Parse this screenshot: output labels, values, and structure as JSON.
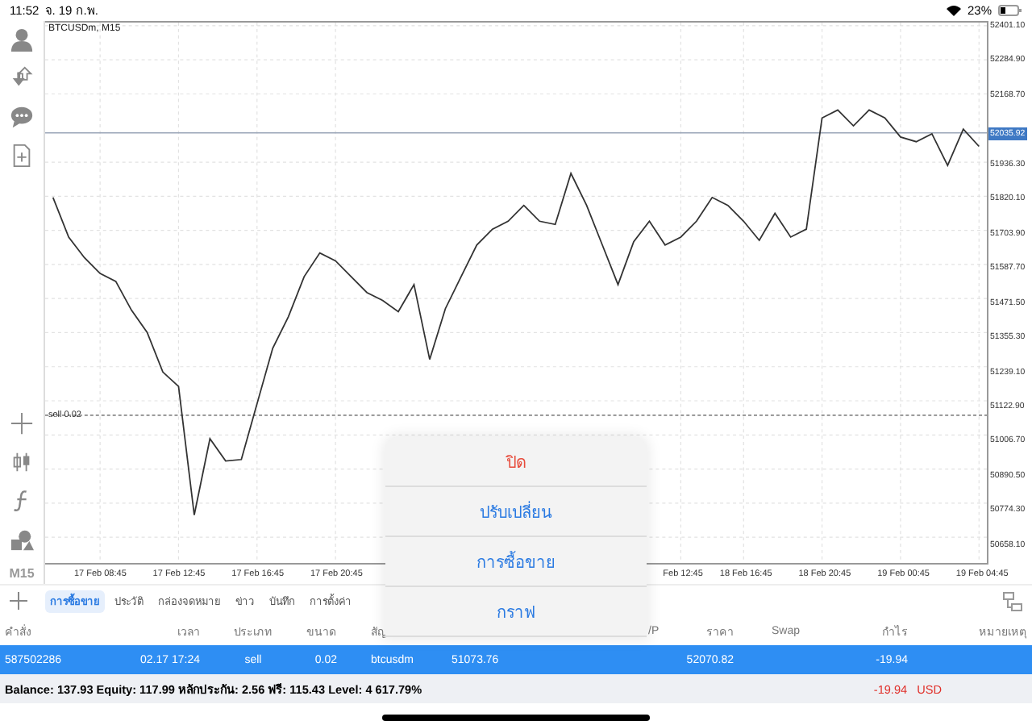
{
  "status_bar": {
    "time": "11:52",
    "date": "จ. 19 ก.พ.",
    "battery": "23%"
  },
  "chart": {
    "timeframe": "M15",
    "chart_data": {
      "type": "line",
      "title": "BTCUSDm, M15",
      "grid": true,
      "ylim": [
        50571.5,
        52411.9
      ],
      "categories": [
        null,
        null,
        null,
        "17 Feb 08:45",
        null,
        null,
        null,
        null,
        "17 Feb 12:45",
        null,
        null,
        null,
        null,
        "17 Feb 16:45",
        null,
        null,
        null,
        null,
        "17 Feb 20:45",
        null,
        null,
        null,
        null,
        null,
        null,
        null,
        null,
        null,
        null,
        null,
        null,
        null,
        null,
        null,
        null,
        null,
        null,
        null,
        null,
        null,
        "Feb 12:45",
        null,
        null,
        null,
        "18 Feb 16:45",
        null,
        null,
        null,
        null,
        "18 Feb 20:45",
        null,
        null,
        null,
        null,
        "19 Feb 00:45",
        null,
        null,
        null,
        null,
        "19 Feb 04:45"
      ],
      "yticks": [
        {
          "value": 52401.1,
          "label": "52401.10"
        },
        {
          "value": 52284.9,
          "label": "52284.90"
        },
        {
          "value": 52168.7,
          "label": "52168.70"
        },
        {
          "value": 51936.3,
          "label": "51936.30"
        },
        {
          "value": 51820.1,
          "label": "51820.10"
        },
        {
          "value": 51703.9,
          "label": "51703.90"
        },
        {
          "value": 51587.7,
          "label": "51587.70"
        },
        {
          "value": 51471.5,
          "label": "51471.50"
        },
        {
          "value": 51355.3,
          "label": "51355.30"
        },
        {
          "value": 51239.1,
          "label": "51239.10"
        },
        {
          "value": 51122.9,
          "label": "51122.90"
        },
        {
          "value": 51006.7,
          "label": "51006.70"
        },
        {
          "value": 50890.5,
          "label": "50890.50"
        },
        {
          "value": 50774.3,
          "label": "50774.30"
        },
        {
          "value": 50658.1,
          "label": "50658.10"
        }
      ],
      "ref_lines": [
        {
          "axis": "y",
          "value": 52035.92,
          "label": "52035.92",
          "color": "#9aa6b8"
        },
        {
          "axis": "y",
          "value": 51073.76,
          "label": "sell 0.02",
          "color": "#888888"
        }
      ],
      "series": [
        {
          "color": "#333333",
          "values": [
            51816,
            51681,
            51611,
            51557,
            51530,
            51432,
            51356,
            51221,
            51172,
            50734,
            50994,
            50918,
            50923,
            51113,
            51302,
            51410,
            51546,
            51627,
            51600,
            51546,
            51492,
            51465,
            51427,
            51519,
            51264,
            51437,
            51546,
            51654,
            51708,
            51735,
            51789,
            51735,
            51724,
            51898,
            51789,
            51654,
            51519,
            51665,
            51735,
            51654,
            51681,
            51735,
            51816,
            51789,
            51735,
            51670,
            51762,
            51681,
            51708,
            52087,
            52114,
            52060,
            52114,
            52087,
            52022,
            52006,
            52033,
            51925,
            52049,
            51990
          ]
        }
      ]
    }
  },
  "tabs": [
    {
      "label": "การซื้อขาย",
      "selected": true
    },
    {
      "label": "ประวัติ",
      "selected": false
    },
    {
      "label": "กล่องจดหมาย",
      "selected": false
    },
    {
      "label": "ข่าว",
      "selected": false
    },
    {
      "label": "บันทึก",
      "selected": false
    },
    {
      "label": "การตั้งค่า",
      "selected": false
    }
  ],
  "table": {
    "columns": [
      "คำสั่ง",
      "เวลา",
      "ประเภท",
      "ขนาด",
      "สัญ",
      null,
      null,
      "/P",
      "ราคา",
      "Swap",
      "กำไร",
      "หมายเหตุ"
    ],
    "rows": [
      {
        "selected": true,
        "cells": [
          "587502286",
          "02.17 17:24",
          "sell",
          "0.02",
          "btcusdm",
          "51073.76",
          null,
          null,
          "52070.82",
          null,
          "-19.94",
          null
        ]
      }
    ]
  },
  "summary": {
    "text": "Balance: 137.93 Equity: 117.99 หลักประกัน: 2.56 ฟรี: 115.43 Level: 4 617.79%",
    "profit": "-19.94",
    "currency": "USD"
  },
  "action_menu": [
    {
      "label": "ปิด",
      "kind": "destructive"
    },
    {
      "label": "ปรับเปลี่ยน",
      "kind": "normal"
    },
    {
      "label": "การซื้อขาย",
      "kind": "normal"
    },
    {
      "label": "กราฟ",
      "kind": "normal"
    }
  ]
}
